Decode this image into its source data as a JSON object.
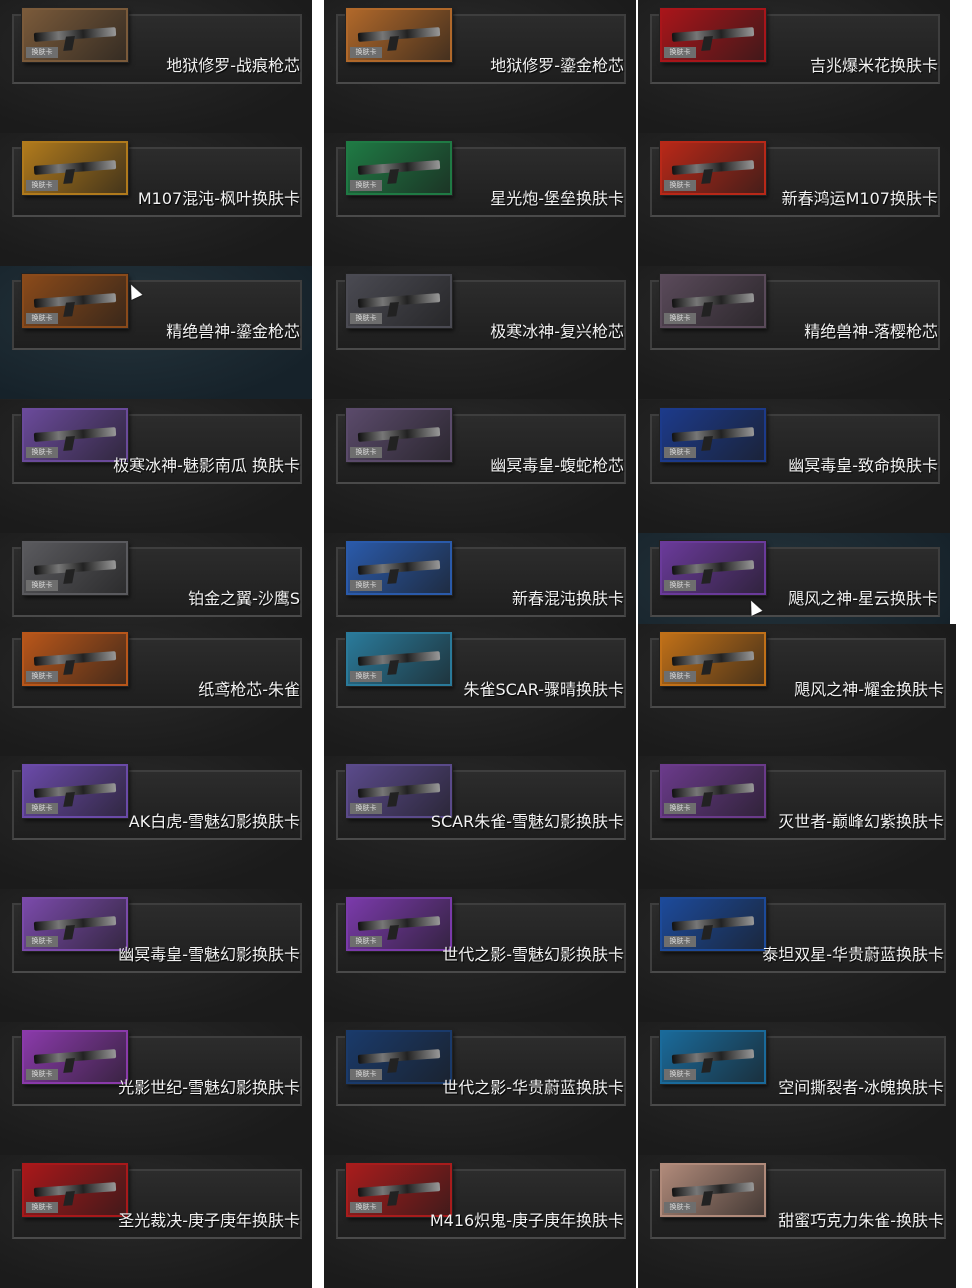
{
  "tag_label": "换肤卡",
  "items": [
    {
      "label": "地狱修罗-战痕枪芯",
      "color": "#7a5a3a"
    },
    {
      "label": "地狱修罗-鎏金枪芯",
      "color": "#b0682a"
    },
    {
      "label": "吉兆爆米花换肤卡",
      "color": "#a8151a"
    },
    {
      "label": "M107混沌-枫叶换肤卡",
      "color": "#b07a1c"
    },
    {
      "label": "星光炮-堡垒换肤卡",
      "color": "#1f7a44"
    },
    {
      "label": "新春鸿运M107换肤卡",
      "color": "#b82818"
    },
    {
      "label": "精绝兽神-鎏金枪芯",
      "color": "#8a4a1a"
    },
    {
      "label": "极寒冰神-复兴枪芯",
      "color": "#4a4a52"
    },
    {
      "label": "精绝兽神-落樱枪芯",
      "color": "#5a4a5a"
    },
    {
      "label": "极寒冰神-魅影南瓜 换肤卡",
      "color": "#6a4a9a"
    },
    {
      "label": "幽冥毒皇-蝮蛇枪芯",
      "color": "#5a4a6a"
    },
    {
      "label": "幽冥毒皇-致命换肤卡",
      "color": "#1c3a8a"
    },
    {
      "label": "铂金之翼-沙鹰S",
      "color": "#5a5a5e"
    },
    {
      "label": "新春混沌换肤卡",
      "color": "#2a5aaa"
    },
    {
      "label": "飓风之神-星云换肤卡",
      "color": "#6a3a9a"
    },
    {
      "label": "纸鸢枪芯-朱雀",
      "color": "#b8561a"
    },
    {
      "label": "朱雀SCAR-骤晴换肤卡",
      "color": "#2a7a9a"
    },
    {
      "label": "飓风之神-耀金换肤卡",
      "color": "#c07018"
    },
    {
      "label": "AK白虎-雪魅幻影换肤卡",
      "color": "#6a4aa8"
    },
    {
      "label": "SCAR朱雀-雪魅幻影换肤卡",
      "color": "#5a4a8a"
    },
    {
      "label": "灭世者-巅峰幻紫换肤卡",
      "color": "#6a3a8a"
    },
    {
      "label": "幽冥毒皇-雪魅幻影换肤卡",
      "color": "#7a4aaa"
    },
    {
      "label": "世代之影-雪魅幻影换肤卡",
      "color": "#7a3aaa"
    },
    {
      "label": "泰坦双星-华贵蔚蓝换肤卡",
      "color": "#1c4a9a"
    },
    {
      "label": "光影世纪-雪魅幻影换肤卡",
      "color": "#8a3aaa"
    },
    {
      "label": "世代之影-华贵蔚蓝换肤卡",
      "color": "#1a3a6a"
    },
    {
      "label": "空间撕裂者-冰魄换肤卡",
      "color": "#1a6a9a"
    },
    {
      "label": "圣光裁决-庚子庚年换肤卡",
      "color": "#a8181a"
    },
    {
      "label": "M416炽鬼-庚子庚年换肤卡",
      "color": "#a81c1c"
    },
    {
      "label": "甜蜜巧克力朱雀-换肤卡",
      "color": "#b08a7a"
    }
  ]
}
